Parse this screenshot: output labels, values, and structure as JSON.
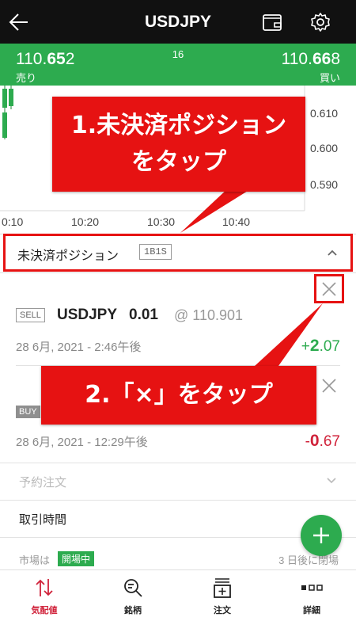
{
  "header": {
    "title": "USDJPY"
  },
  "quote": {
    "sell_prefix": "110.",
    "sell_big": "65",
    "sell_suffix": "2",
    "sell_label": "売り",
    "spread": "16",
    "buy_prefix": "110.",
    "buy_big": "66",
    "buy_suffix": "8",
    "buy_label": "買い"
  },
  "chart": {
    "price_ticks": [
      "0.610",
      "0.600",
      "0.590"
    ],
    "time_ticks": [
      "0:10",
      "10:20",
      "10:30",
      "10:40"
    ]
  },
  "positions": {
    "title": "未決済ポジション",
    "badge": "1B1S",
    "trades": [
      {
        "side": "SELL",
        "symbol": "USDJPY",
        "qty": "0.01",
        "at": "@ 110.901",
        "date": "28 6月, 2021 - 2:46午後",
        "pl_sign": "+",
        "pl_big": "2",
        "pl_small": ".07"
      },
      {
        "side": "BUY",
        "date": "28 6月, 2021 - 12:29午後",
        "pl_sign": "-",
        "pl_big": "0",
        "pl_small": ".67"
      }
    ]
  },
  "rows": {
    "orders": "予約注文",
    "hours": "取引時間",
    "market_prefix": "市場は",
    "market_status": "開場中",
    "market_close": "3 日後に閉場"
  },
  "nav": [
    {
      "label": "気配値",
      "active": true
    },
    {
      "label": "銘柄"
    },
    {
      "label": "注文"
    },
    {
      "label": "詳細"
    }
  ],
  "annotations": {
    "step1_line1": "1.未決済ポジション",
    "step1_line2": "をタップ",
    "step2": "2.「×」をタップ"
  },
  "colors": {
    "header_bg": "#111111",
    "accent_green": "#2dab4f",
    "loss_red": "#d0223a",
    "annotation_red": "#e61212"
  }
}
